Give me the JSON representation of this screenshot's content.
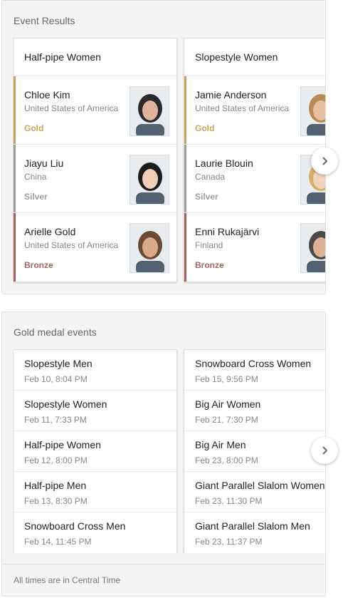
{
  "results": {
    "title": "Event Results",
    "events": [
      {
        "name": "Half-pipe Women",
        "medalists": [
          {
            "name": "Chloe Kim",
            "country": "United States of America",
            "medal": "Gold",
            "color": "#c9a35a"
          },
          {
            "name": "Jiayu Liu",
            "country": "China",
            "medal": "Silver",
            "color": "#9e9e9e"
          },
          {
            "name": "Arielle Gold",
            "country": "United States of America",
            "medal": "Bronze",
            "color": "#a0665a"
          }
        ]
      },
      {
        "name": "Slopestyle Women",
        "medalists": [
          {
            "name": "Jamie Anderson",
            "country": "United States of America",
            "medal": "Gold",
            "color": "#c9a35a"
          },
          {
            "name": "Laurie Blouin",
            "country": "Canada",
            "medal": "Silver",
            "color": "#9e9e9e"
          },
          {
            "name": "Enni Rukajärvi",
            "country": "Finland",
            "medal": "Bronze",
            "color": "#a0665a"
          }
        ]
      }
    ]
  },
  "gold_events": {
    "title": "Gold medal events",
    "columns": [
      [
        {
          "name": "Slopestyle Men",
          "time": "Feb 10, 8:04 PM"
        },
        {
          "name": "Slopestyle Women",
          "time": "Feb 11, 7:33 PM"
        },
        {
          "name": "Half-pipe Women",
          "time": "Feb 12, 8:00 PM"
        },
        {
          "name": "Half-pipe Men",
          "time": "Feb 13, 8:30 PM"
        },
        {
          "name": "Snowboard Cross Men",
          "time": "Feb 14, 11:45 PM"
        }
      ],
      [
        {
          "name": "Snowboard Cross Women",
          "time": "Feb 15, 9:56 PM"
        },
        {
          "name": "Big Air Women",
          "time": "Feb 21, 7:30 PM"
        },
        {
          "name": "Big Air Men",
          "time": "Feb 23, 8:00 PM"
        },
        {
          "name": "Giant Parallel Slalom Women",
          "time": "Feb 23, 11:30 PM"
        },
        {
          "name": "Giant Parallel Slalom Men",
          "time": "Feb 23, 11:37 PM"
        }
      ]
    ],
    "footer": "All times are in Central Time"
  },
  "icons": {
    "next": "chevron-right-icon",
    "photo": "athlete-photo"
  }
}
